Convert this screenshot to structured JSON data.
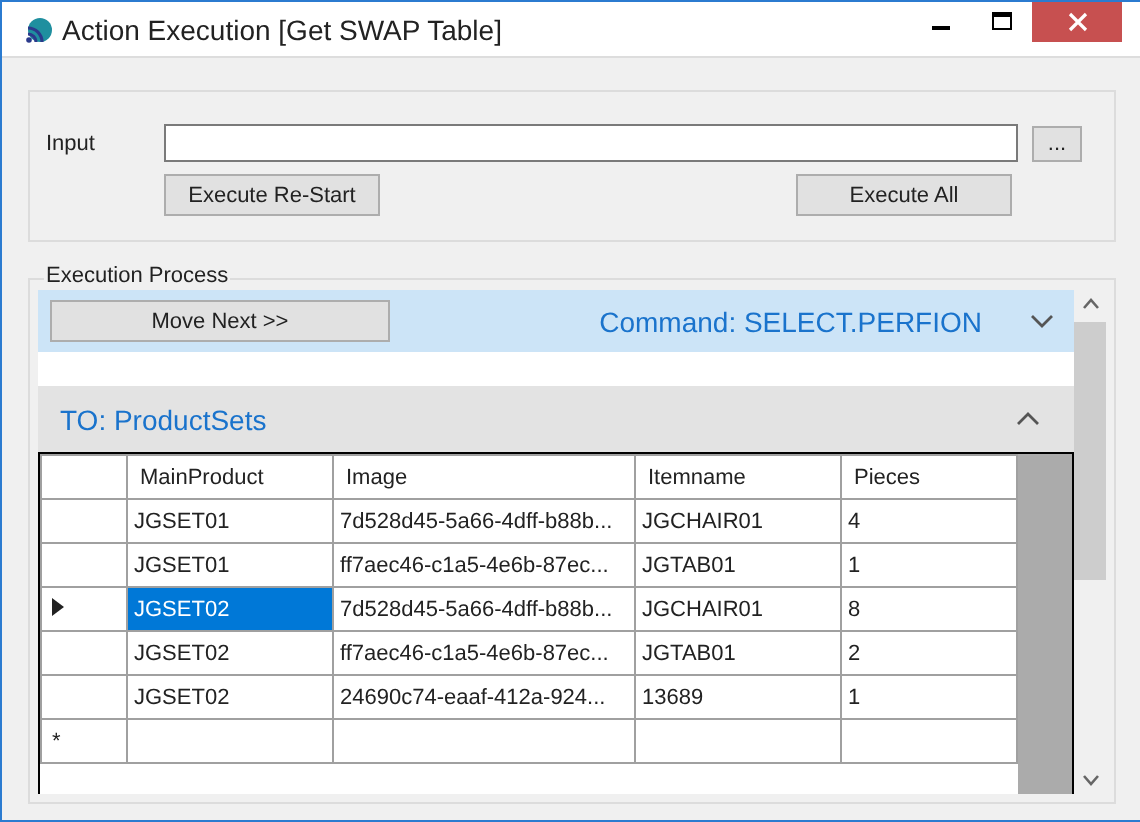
{
  "window": {
    "title": "Action Execution [Get SWAP Table]"
  },
  "input_group": {
    "label": "Input",
    "browse_button": "...",
    "buttons": [
      "Execute Re-Start",
      "Execute All"
    ]
  },
  "execution_process": {
    "title": "Execution Process",
    "command_panel": {
      "button": "Move Next >>",
      "title": "Command: SELECT.PERFION",
      "expanded": false
    },
    "target_panel": {
      "title": "TO: ProductSets",
      "expanded": true
    },
    "table": {
      "columns": [
        "MainProduct",
        "Image",
        "Itemname",
        "Pieces"
      ],
      "rows": [
        {
          "selected": false,
          "cells": [
            "JGSET01",
            "7d528d45-5a66-4dff-b88b...",
            "JGCHAIR01",
            "4"
          ]
        },
        {
          "selected": false,
          "cells": [
            "JGSET01",
            "ff7aec46-c1a5-4e6b-87ec...",
            "JGTAB01",
            "1"
          ]
        },
        {
          "selected": true,
          "cells": [
            "JGSET02",
            "7d528d45-5a66-4dff-b88b...",
            "JGCHAIR01",
            "8"
          ]
        },
        {
          "selected": false,
          "cells": [
            "JGSET02",
            "ff7aec46-c1a5-4e6b-87ec...",
            "JGTAB01",
            "2"
          ]
        },
        {
          "selected": false,
          "cells": [
            "JGSET02",
            "24690c74-eaaf-412a-924...",
            "13689",
            "1"
          ]
        }
      ],
      "new_row_marker": "*"
    }
  }
}
